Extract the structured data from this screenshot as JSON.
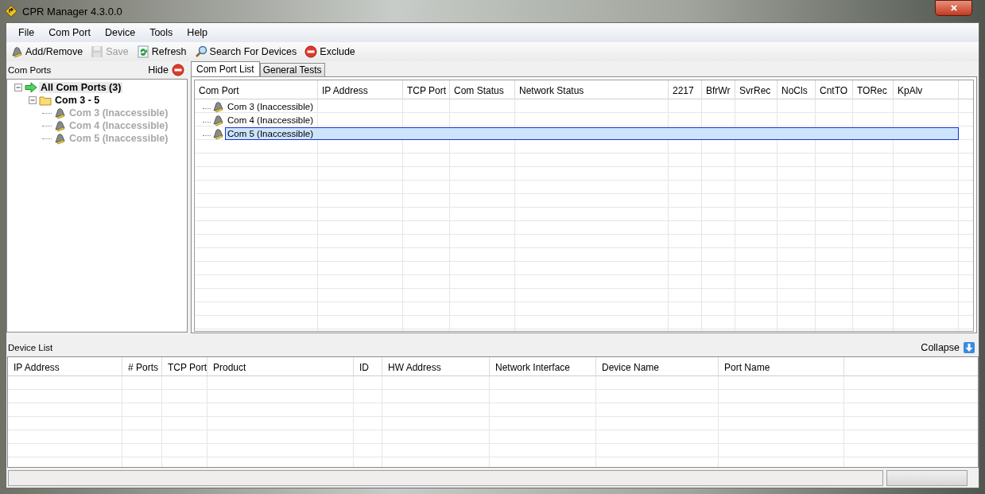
{
  "window": {
    "title": "CPR Manager 4.3.0.0"
  },
  "menu": [
    "File",
    "Com Port",
    "Device",
    "Tools",
    "Help"
  ],
  "toolbar": [
    {
      "label": "Add/Remove",
      "kind": "bell",
      "disabled": false
    },
    {
      "label": "Save",
      "kind": "disk",
      "disabled": true
    },
    {
      "label": "Refresh",
      "kind": "refresh",
      "disabled": false
    },
    {
      "label": "Search For Devices",
      "kind": "search",
      "disabled": false
    },
    {
      "label": "Exclude",
      "kind": "stop",
      "disabled": false
    }
  ],
  "com_ports_panel": {
    "title": "Com Ports",
    "hide_label": "Hide",
    "tree": [
      {
        "label": "All Com Ports (3)",
        "kind": "all",
        "expanded": true,
        "disabled": false,
        "children": [
          {
            "label": "Com 3 - 5",
            "kind": "folder",
            "expanded": true,
            "disabled": false,
            "children": [
              {
                "label": "Com 3 (Inaccessible)",
                "kind": "port",
                "disabled": true
              },
              {
                "label": "Com 4 (Inaccessible)",
                "kind": "port",
                "disabled": true
              },
              {
                "label": "Com 5 (Inaccessible)",
                "kind": "port",
                "disabled": true
              }
            ]
          }
        ]
      }
    ]
  },
  "tabs": [
    {
      "label": "Com Port List",
      "selected": true
    },
    {
      "label": "General Tests",
      "selected": false
    }
  ],
  "com_port_table": {
    "columns": [
      "Com Port",
      "IP Address",
      "TCP Port",
      "Com Status",
      "Network Status",
      "2217",
      "BfrWr",
      "SvrRec",
      "NoCls",
      "CntTO",
      "TORec",
      "KpAlv"
    ],
    "rows": [
      {
        "com_port": "Com 3 (Inaccessible)",
        "selected": false
      },
      {
        "com_port": "Com 4 (Inaccessible)",
        "selected": false
      },
      {
        "com_port": "Com 5 (Inaccessible)",
        "selected": true
      }
    ]
  },
  "device_list": {
    "title": "Device List",
    "collapse_label": "Collapse",
    "columns": [
      "IP Address",
      "# Ports",
      "TCP Port",
      "Product",
      "ID",
      "HW Address",
      "Network Interface",
      "Device Name",
      "Port Name"
    ]
  }
}
